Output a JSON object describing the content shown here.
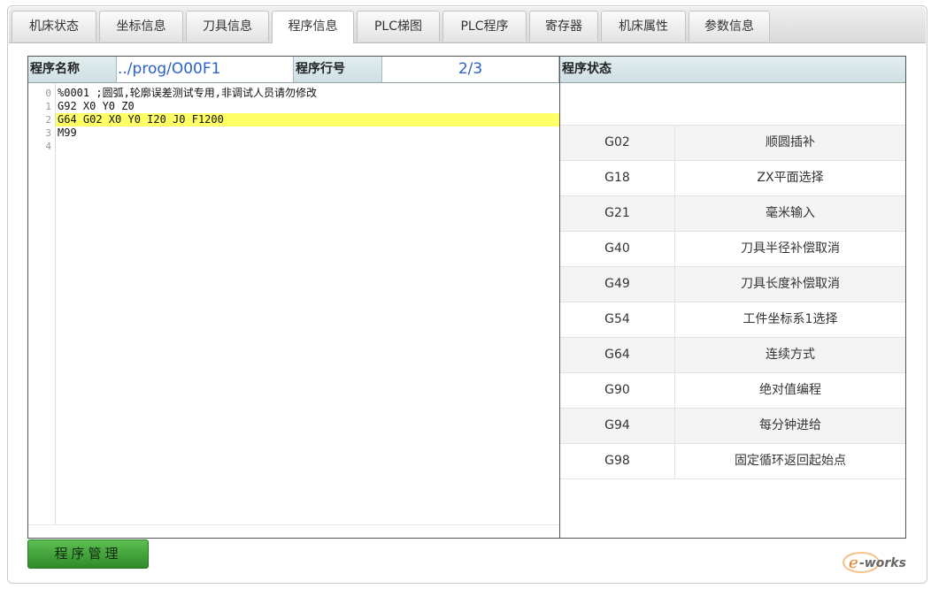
{
  "tabs": [
    {
      "label": "机床状态"
    },
    {
      "label": "坐标信息"
    },
    {
      "label": "刀具信息"
    },
    {
      "label": "程序信息"
    },
    {
      "label": "PLC梯图"
    },
    {
      "label": "PLC程序"
    },
    {
      "label": "寄存器"
    },
    {
      "label": "机床属性"
    },
    {
      "label": "参数信息"
    }
  ],
  "active_tab": "程序信息",
  "program": {
    "name_label": "程序名称",
    "name_value": "../prog/O00F1",
    "line_label": "程序行号",
    "line_value": "2/3",
    "status_label": "程序状态"
  },
  "code": {
    "line_numbers": [
      "0",
      "1",
      "2",
      "3",
      "4"
    ],
    "lines": [
      "%0001 ;圆弧,轮廓误差测试专用,非调试人员请勿修改",
      "G92 X0 Y0 Z0",
      "G64 G02 X0 Y0 I20 J0 F1200",
      "M99",
      ""
    ],
    "highlighted_line": "2"
  },
  "status_rows": [
    {
      "code": "G02",
      "desc": "顺圆插补"
    },
    {
      "code": "G18",
      "desc": "ZX平面选择"
    },
    {
      "code": "G21",
      "desc": "毫米输入"
    },
    {
      "code": "G40",
      "desc": "刀具半径补偿取消"
    },
    {
      "code": "G49",
      "desc": "刀具长度补偿取消"
    },
    {
      "code": "G54",
      "desc": "工件坐标系1选择"
    },
    {
      "code": "G64",
      "desc": "连续方式"
    },
    {
      "code": "G90",
      "desc": "绝对值编程"
    },
    {
      "code": "G94",
      "desc": "每分钟进给"
    },
    {
      "code": "G98",
      "desc": "固定循环返回起始点"
    }
  ],
  "button": {
    "label": "程序管理"
  },
  "watermark": {
    "text": "e-works"
  },
  "colors": {
    "highlight": "#ffff66",
    "value_blue": "#2a62c9",
    "button_green": "#3fa836"
  }
}
